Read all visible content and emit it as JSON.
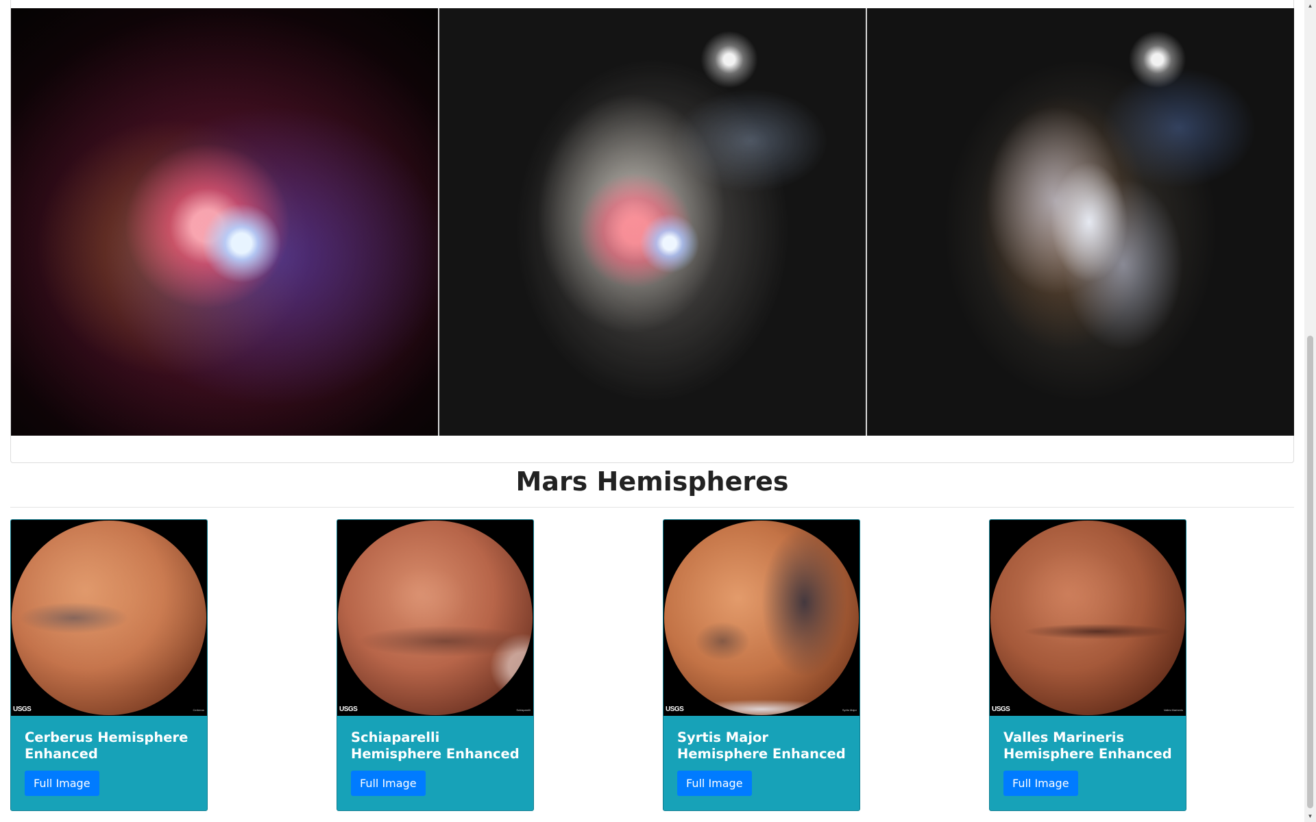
{
  "featured": {
    "panes": [
      {
        "icon": "xray-galaxy-image"
      },
      {
        "icon": "composite-galaxy-image"
      },
      {
        "icon": "optical-galaxy-image"
      }
    ]
  },
  "section": {
    "title": "Mars Hemispheres"
  },
  "hemispheres": [
    {
      "title": "Cerberus Hemisphere Enhanced",
      "button_label": "Full Image",
      "logo": "USGS",
      "caption": "Cerberus"
    },
    {
      "title": "Schiaparelli Hemisphere Enhanced",
      "button_label": "Full Image",
      "logo": "USGS",
      "caption": "Schiaparelli"
    },
    {
      "title": "Syrtis Major Hemisphere Enhanced",
      "button_label": "Full Image",
      "logo": "USGS",
      "caption": "Syrtis Major"
    },
    {
      "title": "Valles Marineris Hemisphere Enhanced",
      "button_label": "Full Image",
      "logo": "USGS",
      "caption": "Valles Marineris"
    }
  ],
  "colors": {
    "card_background": "#17a2b8",
    "button_background": "#007bff",
    "heading_text": "#222222"
  },
  "scrollbar": {
    "up_icon": "scroll-up-arrow-icon",
    "down_icon": "scroll-down-arrow-icon"
  }
}
